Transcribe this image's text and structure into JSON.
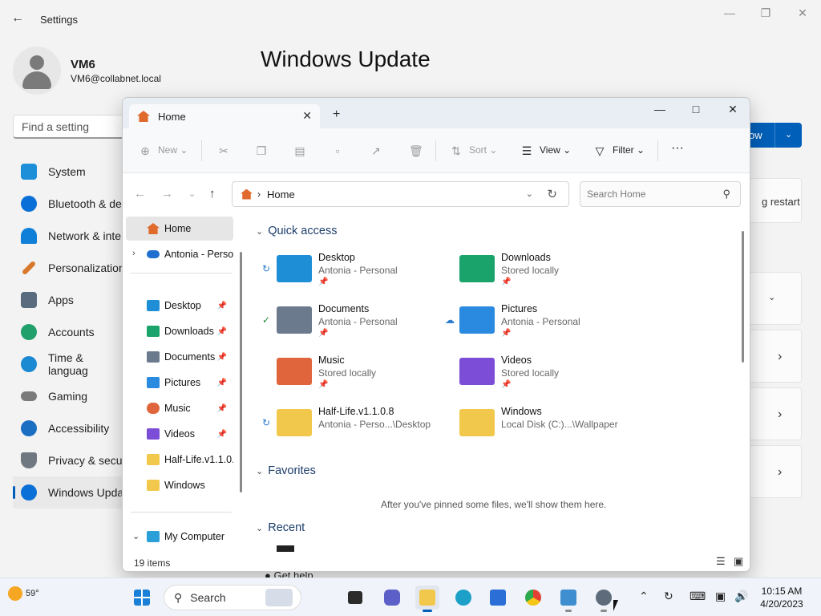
{
  "settings": {
    "title": "Settings",
    "user_name": "VM6",
    "user_email": "VM6@collabnet.local",
    "heading": "Windows Update",
    "find_placeholder": "Find a setting",
    "nav": [
      {
        "label": "System",
        "icon": "system-icon",
        "color": "#1d8fd8"
      },
      {
        "label": "Bluetooth & de",
        "icon": "bluetooth-icon",
        "color": "#0a6fd6"
      },
      {
        "label": "Network & inte",
        "icon": "wifi-icon",
        "color": "#0f7fd8"
      },
      {
        "label": "Personalization",
        "icon": "brush-icon",
        "color": "#d7782c"
      },
      {
        "label": "Apps",
        "icon": "apps-icon",
        "color": "#5a6b80"
      },
      {
        "label": "Accounts",
        "icon": "accounts-icon",
        "color": "#22a06b"
      },
      {
        "label": "Time & languag",
        "icon": "time-icon",
        "color": "#1b8ad3"
      },
      {
        "label": "Gaming",
        "icon": "gaming-icon",
        "color": "#7a7a7a"
      },
      {
        "label": "Accessibility",
        "icon": "accessibility-icon",
        "color": "#1a6fc2"
      },
      {
        "label": "Privacy & secu",
        "icon": "shield-icon",
        "color": "#6f7780"
      },
      {
        "label": "Windows Upda",
        "icon": "update-icon",
        "color": "#0a6fd6"
      }
    ],
    "check_button_fragment": "ow",
    "restart_fragment": "g restart",
    "get_help": "Get help"
  },
  "explorer": {
    "tab_label": "Home",
    "toolbar": {
      "new": "New",
      "sort": "Sort",
      "view": "View",
      "filter": "Filter",
      "more": "···"
    },
    "address": "Home",
    "search_placeholder": "Search Home",
    "sidebar": {
      "home": "Home",
      "cloud": "Antonia - Perso",
      "pinned": [
        {
          "label": "Desktop",
          "icon": "desktop-icon",
          "color": "#1e8fd6"
        },
        {
          "label": "Downloads",
          "icon": "download-icon",
          "color": "#1aa36a"
        },
        {
          "label": "Documents",
          "icon": "documents-icon",
          "color": "#6b7a8c"
        },
        {
          "label": "Pictures",
          "icon": "pictures-icon",
          "color": "#2a8ae0"
        },
        {
          "label": "Music",
          "icon": "music-icon",
          "color": "#e0643c"
        },
        {
          "label": "Videos",
          "icon": "videos-icon",
          "color": "#7c4dd6"
        },
        {
          "label": "Half-Life.v1.1.0.8",
          "icon": "folder-icon",
          "color": "#f1c84b"
        },
        {
          "label": "Windows",
          "icon": "folder-icon",
          "color": "#f1c84b"
        }
      ],
      "my_computer": "My Computer"
    },
    "sections": {
      "quick_access": "Quick access",
      "favorites": "Favorites",
      "favorites_empty": "After you've pinned some files, we'll show them here.",
      "recent": "Recent"
    },
    "quick_access": [
      {
        "name": "Desktop",
        "sub": "Antonia - Personal",
        "status": "sync-icon",
        "color": "#1e8fd6",
        "pinned": true
      },
      {
        "name": "Downloads",
        "sub": "Stored locally",
        "status": "",
        "color": "#1aa36a",
        "pinned": true
      },
      {
        "name": "Documents",
        "sub": "Antonia - Personal",
        "status": "check-icon",
        "color": "#6b7a8c",
        "pinned": true
      },
      {
        "name": "Pictures",
        "sub": "Antonia - Personal",
        "status": "cloud-icon",
        "color": "#2a8ae0",
        "pinned": true
      },
      {
        "name": "Music",
        "sub": "Stored locally",
        "status": "",
        "color": "#e0643c",
        "pinned": true
      },
      {
        "name": "Videos",
        "sub": "Stored locally",
        "status": "",
        "color": "#7c4dd6",
        "pinned": true
      },
      {
        "name": "Half-Life.v1.1.0.8",
        "sub": "Antonia - Perso...\\Desktop",
        "status": "sync-icon",
        "color": "#f1c84b",
        "pinned": false
      },
      {
        "name": "Windows",
        "sub": "Local Disk (C:)...\\Wallpaper",
        "status": "",
        "color": "#f1c84b",
        "pinned": false
      }
    ],
    "status_count": "19 items"
  },
  "taskbar": {
    "temperature": "59°",
    "search_label": "Search",
    "time": "10:15 AM",
    "date": "4/20/2023"
  }
}
